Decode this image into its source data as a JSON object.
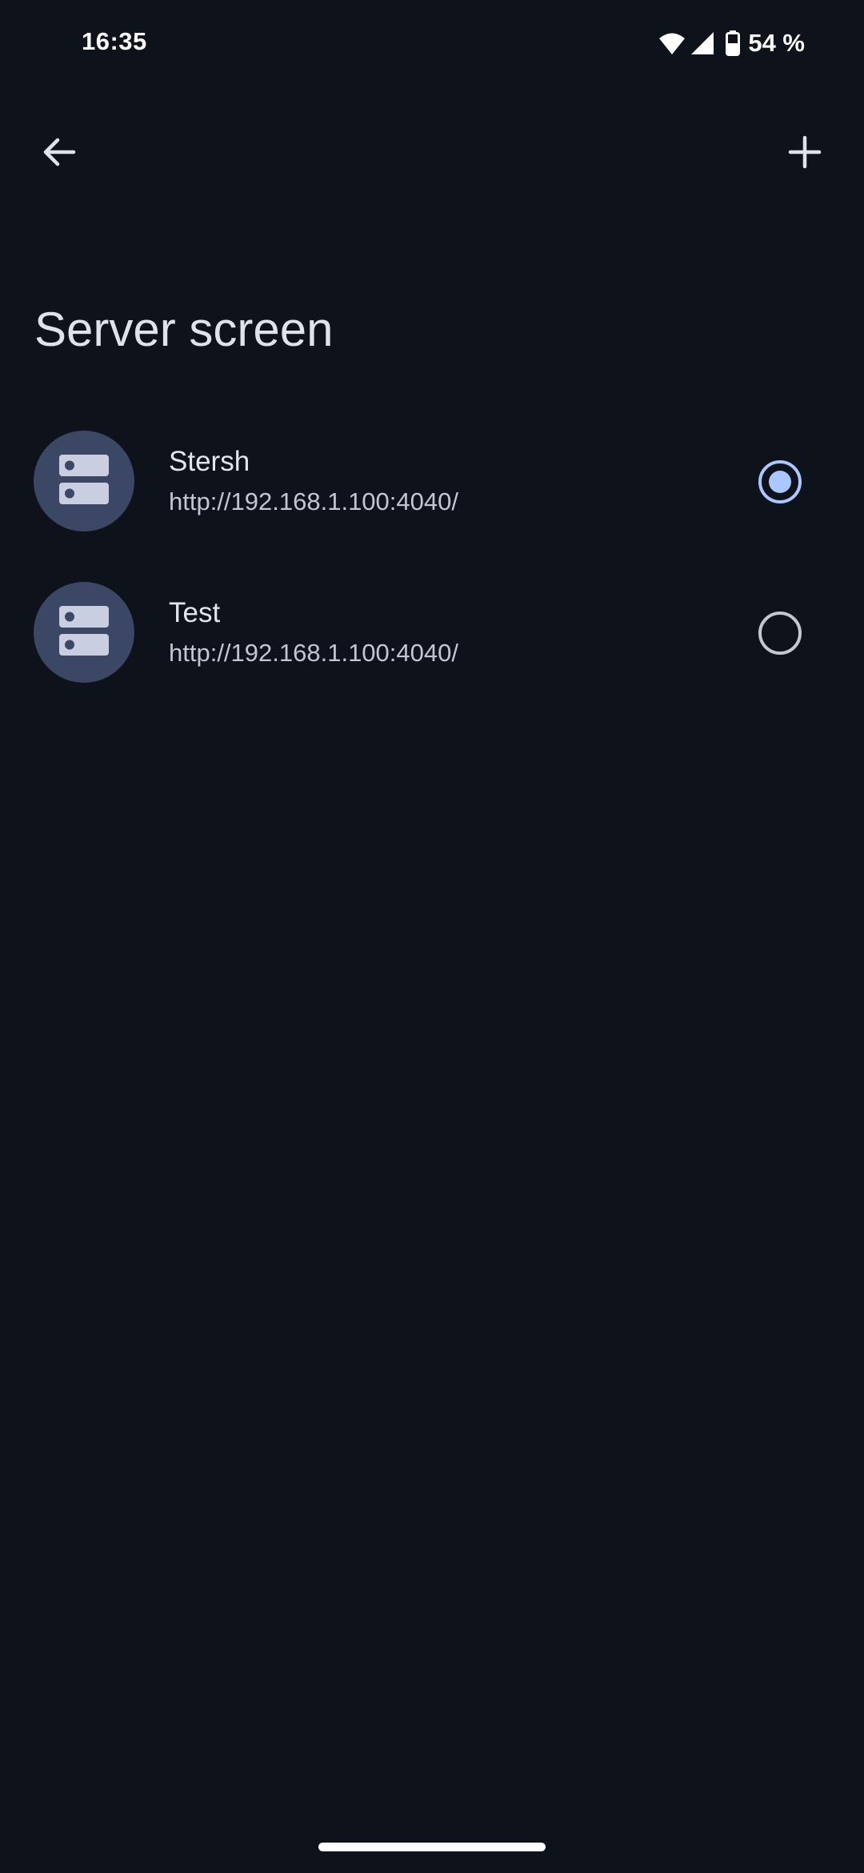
{
  "status_bar": {
    "time": "16:35",
    "battery": "54 %",
    "icons": [
      "wifi-icon",
      "cellular-signal-icon",
      "battery-icon"
    ]
  },
  "toolbar": {
    "back_icon": "arrow-back-icon",
    "add_icon": "plus-icon"
  },
  "page": {
    "title": "Server screen"
  },
  "servers": [
    {
      "name": "Stersh",
      "url": "http://192.168.1.100:4040/",
      "selected": true,
      "icon": "server-icon"
    },
    {
      "name": "Test",
      "url": "http://192.168.1.100:4040/",
      "selected": false,
      "icon": "server-icon"
    }
  ],
  "colors": {
    "background": "#0e131b",
    "avatar": "#3c4665",
    "accent": "#aac7ff",
    "text": "#dfe2eb"
  }
}
